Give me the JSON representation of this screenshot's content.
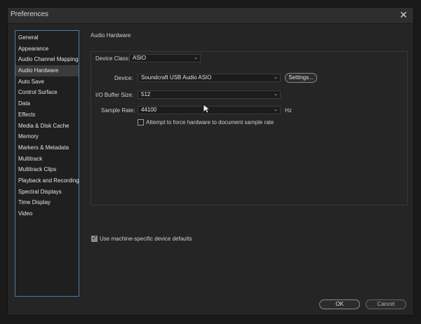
{
  "window": {
    "title": "Preferences"
  },
  "sidebar": {
    "items": [
      {
        "label": "General"
      },
      {
        "label": "Appearance"
      },
      {
        "label": "Audio Channel Mapping"
      },
      {
        "label": "Audio Hardware"
      },
      {
        "label": "Auto Save"
      },
      {
        "label": "Control Surface"
      },
      {
        "label": "Data"
      },
      {
        "label": "Effects"
      },
      {
        "label": "Media & Disk Cache"
      },
      {
        "label": "Memory"
      },
      {
        "label": "Markers & Metadata"
      },
      {
        "label": "Multitrack"
      },
      {
        "label": "Multitrack Clips"
      },
      {
        "label": "Playback and Recording"
      },
      {
        "label": "Spectral Displays"
      },
      {
        "label": "Time Display"
      },
      {
        "label": "Video"
      }
    ],
    "selected": "Audio Hardware"
  },
  "section": {
    "title": "Audio Hardware"
  },
  "device_class": {
    "label": "Device Class:",
    "value": "ASIO"
  },
  "device": {
    "label": "Device:",
    "value": "Soundcraft USB Audio ASIO",
    "settings_label": "Settings..."
  },
  "buffer": {
    "label": "I/O Buffer Size:",
    "value": "512"
  },
  "sample_rate": {
    "label": "Sample Rate:",
    "value": "44100",
    "unit": "Hz"
  },
  "force_rate": {
    "label": "Attempt to force hardware to document sample rate",
    "checked": false
  },
  "machine_defaults": {
    "label": "Use machine-specific device defaults",
    "checked": true
  },
  "footer": {
    "ok_label": "OK",
    "cancel_label": "Cancel"
  },
  "icons": {
    "close": "close-icon",
    "cursor": "mouse-cursor-icon",
    "chevron": "chevron-down-icon"
  }
}
